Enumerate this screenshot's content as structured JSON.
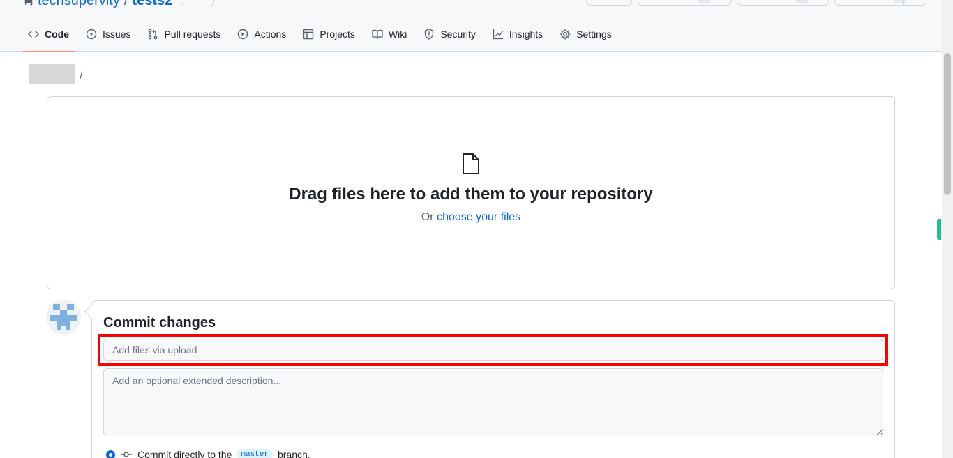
{
  "repo": {
    "owner": "techsupervity",
    "separator": "/",
    "name": "tests2"
  },
  "tabs": [
    {
      "label": "Code",
      "icon": "code-icon",
      "active": true
    },
    {
      "label": "Issues",
      "icon": "issue-opened-icon",
      "active": false
    },
    {
      "label": "Pull requests",
      "icon": "git-pull-request-icon",
      "active": false
    },
    {
      "label": "Actions",
      "icon": "play-icon",
      "active": false
    },
    {
      "label": "Projects",
      "icon": "table-icon",
      "active": false
    },
    {
      "label": "Wiki",
      "icon": "book-icon",
      "active": false
    },
    {
      "label": "Security",
      "icon": "shield-icon",
      "active": false
    },
    {
      "label": "Insights",
      "icon": "graph-icon",
      "active": false
    },
    {
      "label": "Settings",
      "icon": "gear-icon",
      "active": false
    }
  ],
  "breadcrumb": {
    "separator": "/"
  },
  "dropzone": {
    "icon": "file-icon",
    "title": "Drag files here to add them to your repository",
    "sub_prefix": "Or ",
    "sub_link": "choose your files"
  },
  "commit": {
    "title": "Commit changes",
    "summary_placeholder": "Add files via upload",
    "description_placeholder": "Add an optional extended description...",
    "option_prefix": "Commit directly to the",
    "branch": "master",
    "option_suffix": "branch."
  },
  "colors": {
    "accent": "#0969da",
    "active_tab_underline": "#fd8c73",
    "highlight": "#ff0000"
  }
}
